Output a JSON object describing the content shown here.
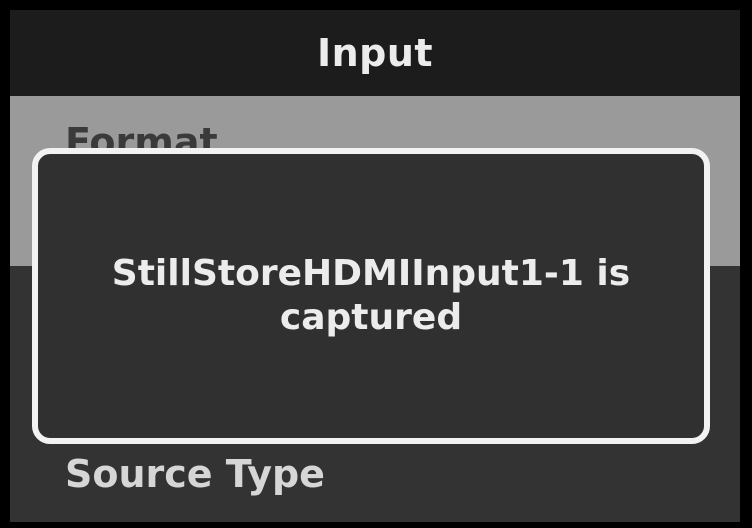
{
  "header": {
    "title": "Input"
  },
  "menu": {
    "items": [
      {
        "label": "Format"
      },
      {
        "label": "Source Type"
      }
    ]
  },
  "notification": {
    "line1": "StillStoreHDMIInput1-1 is",
    "line2": "captured"
  },
  "colors": {
    "header_bg": "#1c1c1c",
    "selected_item_bg": "#9a9a9a",
    "body_bg": "#333333",
    "toast_border": "#f2f2f2"
  }
}
